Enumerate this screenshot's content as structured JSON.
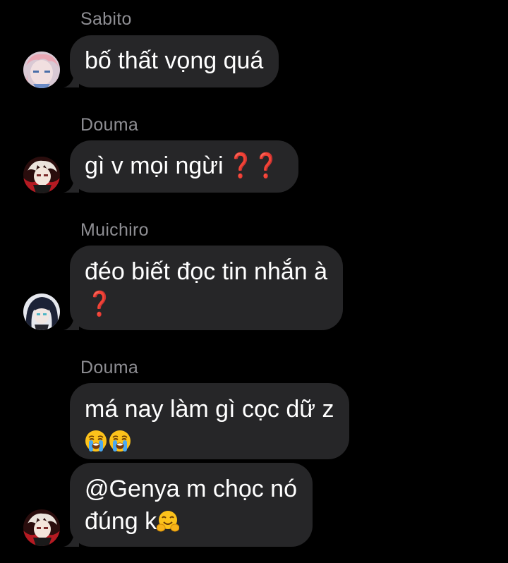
{
  "conversation": {
    "messages": [
      {
        "sender": "Sabito",
        "avatar_icon": "sabito-avatar",
        "lines": [
          "bố thất vọng quá"
        ]
      },
      {
        "sender": "Douma",
        "avatar_icon": "douma-avatar",
        "text": "gì v mọi ngừi",
        "marks": "❓❓"
      },
      {
        "sender": "Muichiro",
        "avatar_icon": "muichiro-avatar",
        "text": "đéo biết đọc tin nhắn à",
        "marks": "❓"
      },
      {
        "sender": "Douma",
        "text": "má nay làm gì cọc dữ z",
        "emojis": [
          "loudly-crying-face-icon",
          "loudly-crying-face-icon"
        ]
      },
      {
        "avatar_icon": "douma-avatar",
        "lines": [
          "@Genya m chọc nó",
          "đúng k"
        ],
        "emojis": [
          "hugging-face-icon"
        ]
      }
    ]
  },
  "colors": {
    "background": "#000000",
    "bubble": "#262628",
    "sender_name": "#8e8e93",
    "text": "#ffffff",
    "question_mark": "#d0161b"
  }
}
